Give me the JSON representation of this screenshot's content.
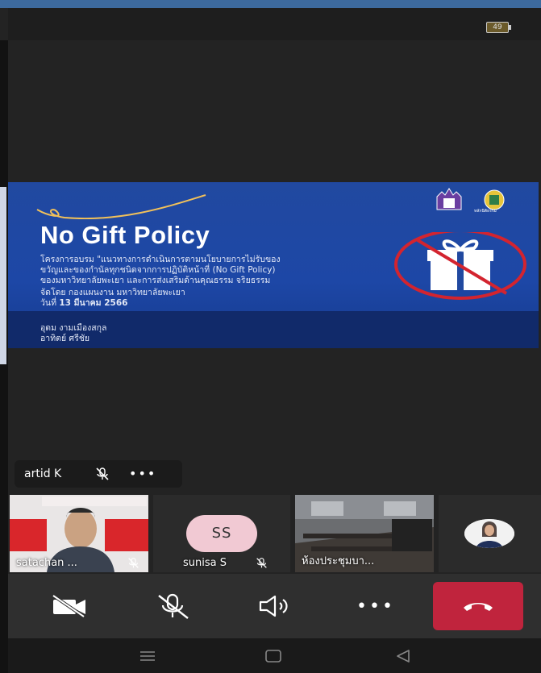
{
  "status": {
    "battery": "49"
  },
  "slide": {
    "title": "No Gift Policy",
    "line1": "โครงการอบรม \"แนวทางการดำเนินการตามนโยบายการไม่รับของ",
    "line2": "ขวัญและของกำนัลทุกชนิดจากการปฏิบัติหน้าที่ (No Gift Policy)",
    "line3": "ของมหาวิทยาลัยพะเยา และการส่งเสริมด้านคุณธรรม จริยธรรม",
    "line4": "จัดโดย กองแผนงาน มหาวิทยาลัยพะเยา",
    "line5_prefix": "วันที่ ",
    "line5_bold": "13 มีนาคม 2566",
    "presenter1": "อุดม งามเมืองสกุล",
    "presenter2": "อาทิตย์ ศรีชัย",
    "logo_caption": "หลักนิติธรรม"
  },
  "self_tile": {
    "name": "artid K",
    "more": "•••"
  },
  "participants": [
    {
      "label": "satachan ...",
      "muted": true
    },
    {
      "label": "sunisa S",
      "initials": "SS",
      "muted": true
    },
    {
      "label": "ห้องประชุมบา...",
      "muted": false
    },
    {
      "label": "",
      "muted": false
    }
  ],
  "controls": {
    "camera": "camera-off-icon",
    "mic": "mic-off-icon",
    "speaker": "speaker-icon",
    "more": "•••",
    "end_color": "#c0243d"
  },
  "navbar": {
    "items": [
      "menu-icon",
      "home-icon",
      "back-icon"
    ]
  }
}
